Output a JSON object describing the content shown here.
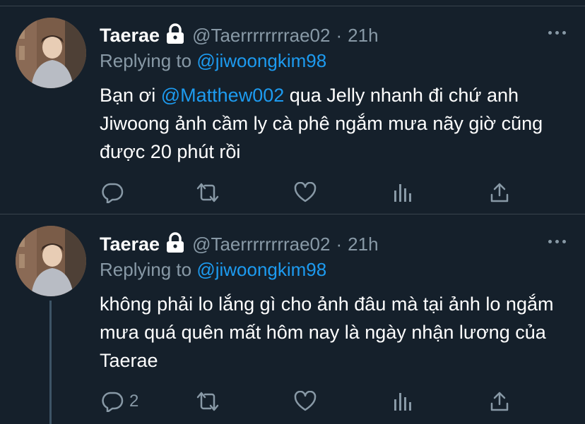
{
  "tweets": [
    {
      "name": "Taerae",
      "handle": "@Taerrrrrrrrae02",
      "separator": "·",
      "time": "21h",
      "replying_prefix": "Replying to",
      "replying_to": "@jiwoongkim98",
      "text_before": "Bạn ơi ",
      "mention": "@Matthew002",
      "text_after": " qua Jelly nhanh đi chứ anh Jiwoong ảnh cầm ly cà phê ngắm mưa nãy giờ cũng được 20 phút rồi",
      "reply_count": ""
    },
    {
      "name": "Taerae",
      "handle": "@Taerrrrrrrrae02",
      "separator": "·",
      "time": "21h",
      "replying_prefix": "Replying to",
      "replying_to": "@jiwoongkim98",
      "text": "không phải lo lắng gì cho ảnh đâu mà tại ảnh lo ngắm mưa quá quên mất hôm nay là ngày nhận lương của Taerae",
      "reply_count": "2"
    }
  ],
  "colors": {
    "background": "#15202b",
    "divider": "#38444d",
    "muted": "#8899a6",
    "accent": "#1d9bf0",
    "text": "#ffffff"
  },
  "icons": [
    "lock-icon",
    "more-icon",
    "reply-icon",
    "retweet-icon",
    "like-icon",
    "analytics-icon",
    "share-icon"
  ]
}
